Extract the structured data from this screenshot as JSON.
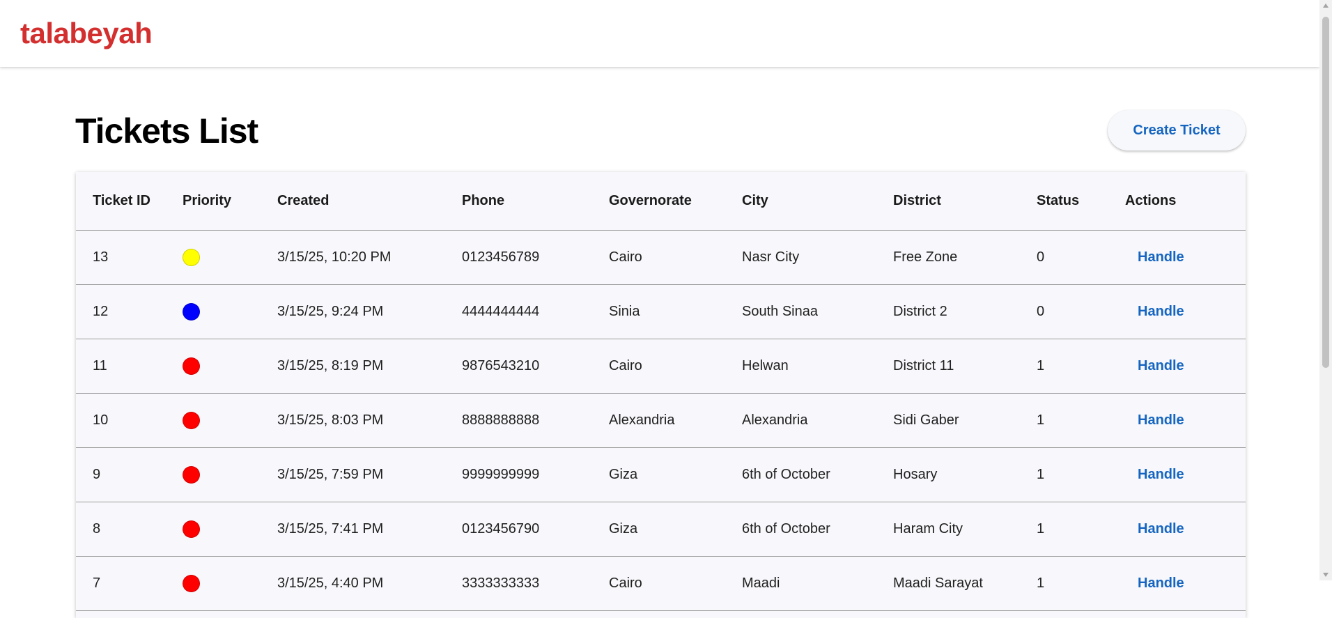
{
  "brand": {
    "name": "talabeyah",
    "color": "#d32f2f"
  },
  "page": {
    "title": "Tickets List",
    "create_button_label": "Create Ticket"
  },
  "colors": {
    "link": "#1565c0",
    "priority": {
      "yellow": "#ffff00",
      "blue": "#0000ff",
      "red": "#ff0000"
    }
  },
  "table": {
    "columns": [
      "Ticket ID",
      "Priority",
      "Created",
      "Phone",
      "Governorate",
      "City",
      "District",
      "Status",
      "Actions"
    ],
    "rows": [
      {
        "id": "13",
        "priority": "yellow",
        "created": "3/15/25, 10:20 PM",
        "phone": "0123456789",
        "governorate": "Cairo",
        "city": "Nasr City",
        "district": "Free Zone",
        "status": "0",
        "action": "Handle"
      },
      {
        "id": "12",
        "priority": "blue",
        "created": "3/15/25, 9:24 PM",
        "phone": "4444444444",
        "governorate": "Sinia",
        "city": "South Sinaa",
        "district": "District 2",
        "status": "0",
        "action": "Handle"
      },
      {
        "id": "11",
        "priority": "red",
        "created": "3/15/25, 8:19 PM",
        "phone": "9876543210",
        "governorate": "Cairo",
        "city": "Helwan",
        "district": "District 11",
        "status": "1",
        "action": "Handle"
      },
      {
        "id": "10",
        "priority": "red",
        "created": "3/15/25, 8:03 PM",
        "phone": "8888888888",
        "governorate": "Alexandria",
        "city": "Alexandria",
        "district": "Sidi Gaber",
        "status": "1",
        "action": "Handle"
      },
      {
        "id": "9",
        "priority": "red",
        "created": "3/15/25, 7:59 PM",
        "phone": "9999999999",
        "governorate": "Giza",
        "city": "6th of October",
        "district": "Hosary",
        "status": "1",
        "action": "Handle"
      },
      {
        "id": "8",
        "priority": "red",
        "created": "3/15/25, 7:41 PM",
        "phone": "0123456790",
        "governorate": "Giza",
        "city": "6th of October",
        "district": "Haram City",
        "status": "1",
        "action": "Handle"
      },
      {
        "id": "7",
        "priority": "red",
        "created": "3/15/25, 4:40 PM",
        "phone": "3333333333",
        "governorate": "Cairo",
        "city": "Maadi",
        "district": "Maadi Sarayat",
        "status": "1",
        "action": "Handle"
      }
    ]
  }
}
